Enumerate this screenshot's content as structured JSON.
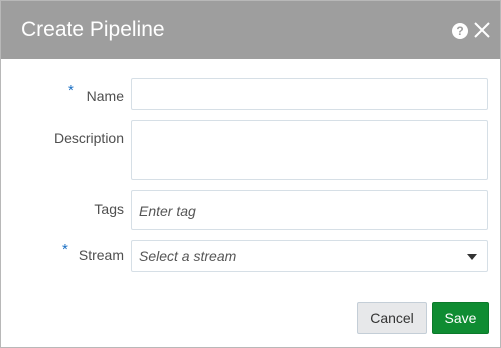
{
  "dialog": {
    "title": "Create Pipeline",
    "help_icon": "help-icon",
    "close_icon": "close-icon"
  },
  "form": {
    "required_marker": "*",
    "name": {
      "label": "Name",
      "value": "",
      "required": true
    },
    "description": {
      "label": "Description",
      "value": ""
    },
    "tags": {
      "label": "Tags",
      "placeholder": "Enter tag"
    },
    "stream": {
      "label": "Stream",
      "placeholder": "Select a stream",
      "required": true
    }
  },
  "buttons": {
    "cancel": "Cancel",
    "save": "Save"
  },
  "colors": {
    "titlebar": "#9e9e9e",
    "required_marker": "#1a6fc4",
    "save_button": "#0f8c32",
    "cancel_button": "#e7e8ea"
  }
}
